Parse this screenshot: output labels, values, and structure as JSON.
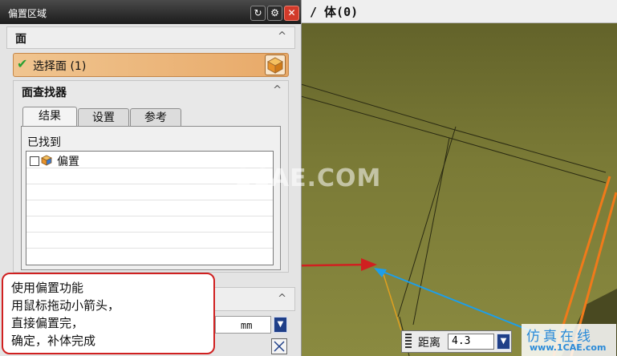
{
  "window": {
    "title": "偏置区域"
  },
  "viewport": {
    "title": "/ 体(0)"
  },
  "section_face": {
    "label": "面",
    "collapse": "^"
  },
  "select_face": {
    "label": "选择面 (1)"
  },
  "face_finder": {
    "label": "面查找器",
    "collapse": "^",
    "tabs": [
      {
        "label": "结果"
      },
      {
        "label": "设置"
      },
      {
        "label": "参考"
      }
    ],
    "found_label": "已找到",
    "results": [
      {
        "label": "偏置"
      }
    ]
  },
  "offset_section": {
    "collapse": "^",
    "unit": "mm"
  },
  "callout": {
    "lines": [
      "使用偏置功能",
      "用鼠标拖动小箭头，",
      "直接偏置完，",
      "确定，补体完成"
    ]
  },
  "distance": {
    "label": "距离",
    "value": "4.3"
  },
  "watermarks": {
    "center": "1CAE.COM",
    "brand_cn": "仿真在线",
    "brand_url": "www.1CAE.com"
  },
  "colors": {
    "callout_border": "#d02020",
    "arrow_red": "#d02020",
    "drag_arrow": "#1e9ee8",
    "edge_orange": "#f07a1a"
  },
  "icons": {
    "refresh": "refresh-icon",
    "gear": "gear-icon",
    "close": "close-icon",
    "check": "check-icon",
    "cube": "cube-icon",
    "dropdown": "chevron-down-icon"
  }
}
